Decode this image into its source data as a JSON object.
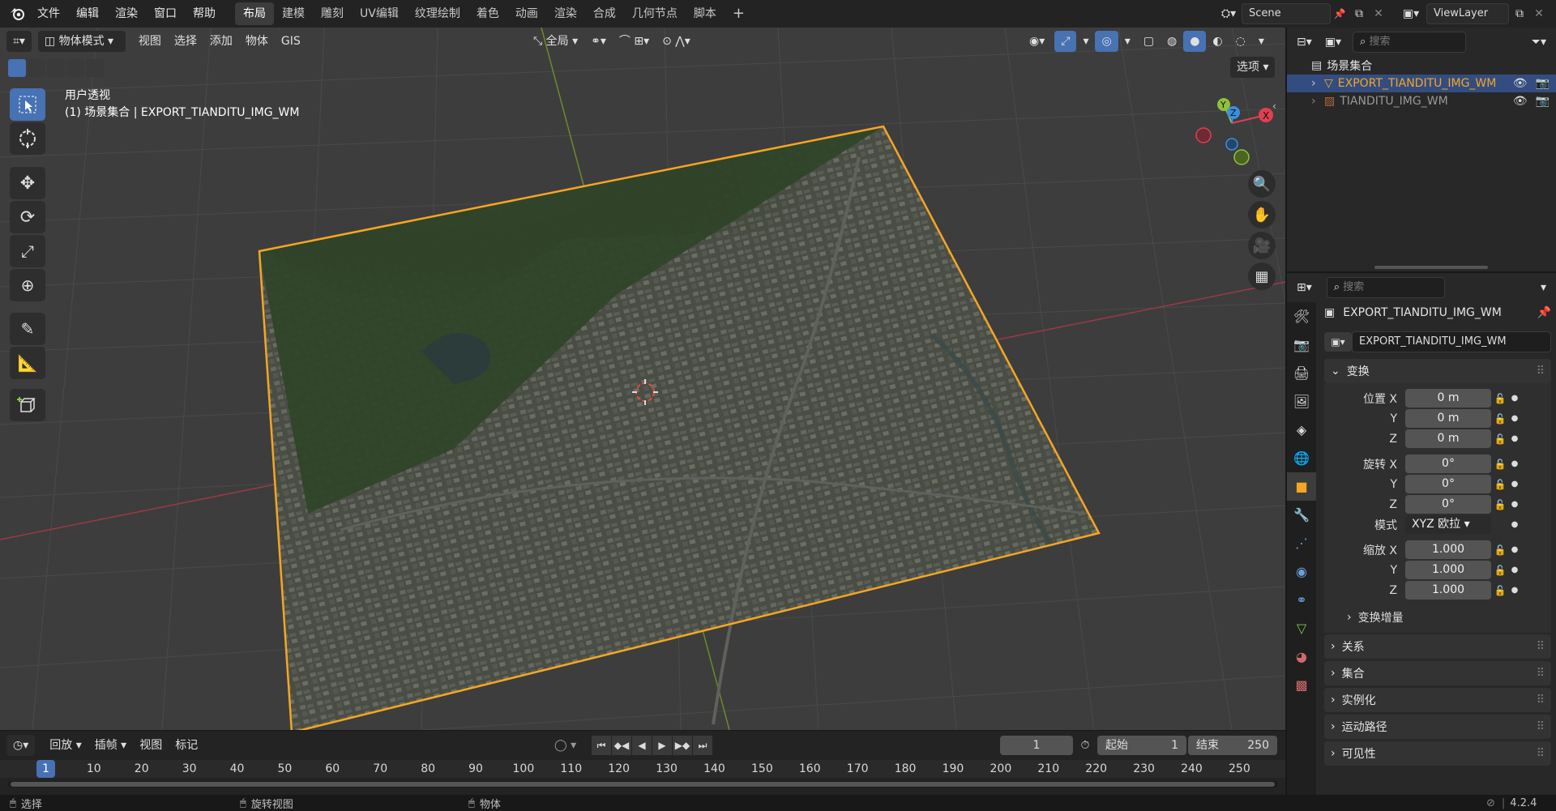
{
  "topbar": {
    "menus": [
      "文件",
      "编辑",
      "渲染",
      "窗口",
      "帮助"
    ],
    "workspaces": [
      "布局",
      "建模",
      "雕刻",
      "UV编辑",
      "纹理绘制",
      "着色",
      "动画",
      "渲染",
      "合成",
      "几何节点",
      "脚本"
    ],
    "active_workspace": "布局",
    "add_tab": "+",
    "scene": "Scene",
    "view_layer": "ViewLayer"
  },
  "viewport": {
    "mode": "物体模式",
    "menus": [
      "视图",
      "选择",
      "添加",
      "物体",
      "GIS"
    ],
    "transform_orientation": "全局",
    "options": "选项",
    "view_name": "用户透视",
    "active_info": "(1) 场景集合 | EXPORT_TIANDITU_IMG_WM",
    "gizmo": {
      "x": "X",
      "y": "Y",
      "z": "Z"
    }
  },
  "tools": [
    "select-box",
    "cursor",
    "move",
    "rotate",
    "scale",
    "transform",
    "annotate",
    "measure",
    "add-cube"
  ],
  "outliner": {
    "search_placeholder": "搜索",
    "root": "场景集合",
    "items": [
      {
        "name": "EXPORT_TIANDITU_IMG_WM",
        "selected": true
      },
      {
        "name": "TIANDITU_IMG_WM",
        "selected": false
      }
    ]
  },
  "properties": {
    "search_placeholder": "搜索",
    "object_name": "EXPORT_TIANDITU_IMG_WM",
    "object_datablock": "EXPORT_TIANDITU_IMG_WM",
    "transform_title": "变换",
    "location_label": "位置 X",
    "rotation_label": "旋转 X",
    "scale_label": "缩放 X",
    "y_label": "Y",
    "z_label": "Z",
    "location": [
      "0 m",
      "0 m",
      "0 m"
    ],
    "rotation": [
      "0°",
      "0°",
      "0°"
    ],
    "mode_label": "模式",
    "rotation_mode": "XYZ 欧拉",
    "scale": [
      "1.000",
      "1.000",
      "1.000"
    ],
    "delta_transform": "变换增量",
    "panels": [
      "关系",
      "集合",
      "实例化",
      "运动路径",
      "可见性"
    ]
  },
  "timeline": {
    "menus": [
      "回放",
      "插帧",
      "视图",
      "标记"
    ],
    "current_frame": "1",
    "start_label": "起始",
    "start": "1",
    "end_label": "结束",
    "end": "250",
    "ticks": [
      "1",
      "10",
      "20",
      "30",
      "40",
      "50",
      "60",
      "70",
      "80",
      "90",
      "100",
      "110",
      "120",
      "130",
      "140",
      "150",
      "160",
      "170",
      "180",
      "190",
      "200",
      "210",
      "220",
      "230",
      "240",
      "250"
    ]
  },
  "statusbar": {
    "select": "选择",
    "rotate_view": "旋转视图",
    "object": "物体",
    "version": "4.2.4"
  },
  "colors": {
    "accent_blue": "#4772b3",
    "selection_orange": "#f5a623",
    "x_axis": "#e04050",
    "y_axis": "#8fc23a",
    "z_axis": "#3b8fe0"
  }
}
